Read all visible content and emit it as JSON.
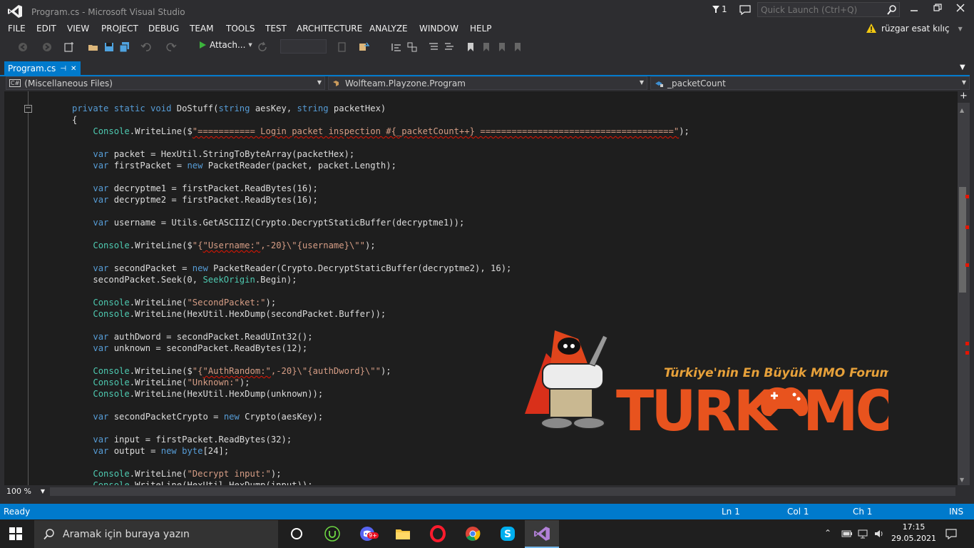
{
  "window": {
    "title": "Program.cs - Microsoft Visual Studio",
    "notification_count": "1",
    "quick_launch_placeholder": "Quick Launch (Ctrl+Q)",
    "user_name": "rüzgar esat kılıç"
  },
  "menu": [
    "FILE",
    "EDIT",
    "VIEW",
    "PROJECT",
    "DEBUG",
    "TEAM",
    "TOOLS",
    "TEST",
    "ARCHITECTURE",
    "ANALYZE",
    "WINDOW",
    "HELP"
  ],
  "toolbar": {
    "attach_label": "Attach..."
  },
  "tab": {
    "label": "Program.cs",
    "pin_glyph": "⊣",
    "close_glyph": "✕"
  },
  "nav": {
    "project": "(Miscellaneous Files)",
    "type": "Wolfteam.Playzone.Program",
    "member": "_packetCount"
  },
  "code_lines": [
    [
      [
        "",
        "private static void "
      ],
      [
        "",
        "DoStuff("
      ],
      [
        "kw",
        "string"
      ],
      [
        "",
        " aesKey, "
      ],
      [
        "kw",
        "string"
      ],
      [
        "",
        " packetHex)"
      ]
    ],
    [
      [
        "",
        "{"
      ]
    ],
    [
      [
        "",
        "    "
      ],
      [
        "ty",
        "Console"
      ],
      [
        "",
        ".WriteLine($"
      ],
      [
        "st squig",
        "\"=========== Login packet inspection #{_packetCount++} =====================================\""
      ],
      [
        "",
        ");"
      ]
    ],
    [],
    [
      [
        "",
        "    "
      ],
      [
        "kw",
        "var"
      ],
      [
        "",
        " packet = HexUtil.StringToByteArray(packetHex);"
      ]
    ],
    [
      [
        "",
        "    "
      ],
      [
        "kw",
        "var"
      ],
      [
        "",
        " firstPacket = "
      ],
      [
        "kw",
        "new"
      ],
      [
        "",
        " PacketReader(packet, packet.Length);"
      ]
    ],
    [],
    [
      [
        "",
        "    "
      ],
      [
        "kw",
        "var"
      ],
      [
        "",
        " decryptme1 = firstPacket.ReadBytes(16);"
      ]
    ],
    [
      [
        "",
        "    "
      ],
      [
        "kw",
        "var"
      ],
      [
        "",
        " decryptme2 = firstPacket.ReadBytes(16);"
      ]
    ],
    [],
    [
      [
        "",
        "    "
      ],
      [
        "kw",
        "var"
      ],
      [
        "",
        " username = Utils.GetASCIIZ(Crypto.DecryptStaticBuffer(decryptme1));"
      ]
    ],
    [],
    [
      [
        "",
        "    "
      ],
      [
        "ty",
        "Console"
      ],
      [
        "",
        ".WriteLine($"
      ],
      [
        "st",
        "\"{"
      ],
      [
        "st squig",
        "\"Username:\""
      ],
      [
        "st",
        ",-20}\\\"{username}\\\"\""
      ],
      [
        "",
        ");"
      ]
    ],
    [],
    [
      [
        "",
        "    "
      ],
      [
        "kw",
        "var"
      ],
      [
        "",
        " secondPacket = "
      ],
      [
        "kw",
        "new"
      ],
      [
        "",
        " PacketReader(Crypto.DecryptStaticBuffer(decryptme2), 16);"
      ]
    ],
    [
      [
        "",
        "    secondPacket.Seek(0, "
      ],
      [
        "ty",
        "SeekOrigin"
      ],
      [
        "",
        ".Begin);"
      ]
    ],
    [],
    [
      [
        "",
        "    "
      ],
      [
        "ty",
        "Console"
      ],
      [
        "",
        ".WriteLine("
      ],
      [
        "st",
        "\"SecondPacket:\""
      ],
      [
        "",
        ");"
      ]
    ],
    [
      [
        "",
        "    "
      ],
      [
        "ty",
        "Console"
      ],
      [
        "",
        ".WriteLine(HexUtil.HexDump(secondPacket.Buffer));"
      ]
    ],
    [],
    [
      [
        "",
        "    "
      ],
      [
        "kw",
        "var"
      ],
      [
        "",
        " authDword = secondPacket.ReadUInt32();"
      ]
    ],
    [
      [
        "",
        "    "
      ],
      [
        "kw",
        "var"
      ],
      [
        "",
        " unknown = secondPacket.ReadBytes(12);"
      ]
    ],
    [],
    [
      [
        "",
        "    "
      ],
      [
        "ty",
        "Console"
      ],
      [
        "",
        ".WriteLine($"
      ],
      [
        "st",
        "\"{"
      ],
      [
        "st squig",
        "\"AuthRandom:\""
      ],
      [
        "st",
        ",-20}\\\"{authDword}\\\"\""
      ],
      [
        "",
        ");"
      ]
    ],
    [
      [
        "",
        "    "
      ],
      [
        "ty",
        "Console"
      ],
      [
        "",
        ".WriteLine("
      ],
      [
        "st",
        "\"Unknown:\""
      ],
      [
        "",
        ");"
      ]
    ],
    [
      [
        "",
        "    "
      ],
      [
        "ty",
        "Console"
      ],
      [
        "",
        ".WriteLine(HexUtil.HexDump(unknown));"
      ]
    ],
    [],
    [
      [
        "",
        "    "
      ],
      [
        "kw",
        "var"
      ],
      [
        "",
        " secondPacketCrypto = "
      ],
      [
        "kw",
        "new"
      ],
      [
        "",
        " Crypto(aesKey);"
      ]
    ],
    [],
    [
      [
        "",
        "    "
      ],
      [
        "kw",
        "var"
      ],
      [
        "",
        " input = firstPacket.ReadBytes(32);"
      ]
    ],
    [
      [
        "",
        "    "
      ],
      [
        "kw",
        "var"
      ],
      [
        "",
        " output = "
      ],
      [
        "kw",
        "new"
      ],
      [
        "",
        " "
      ],
      [
        "kw",
        "byte"
      ],
      [
        "",
        "[24];"
      ]
    ],
    [],
    [
      [
        "",
        "    "
      ],
      [
        "ty",
        "Console"
      ],
      [
        "",
        ".WriteLine("
      ],
      [
        "st",
        "\"Decrypt input:\""
      ],
      [
        "",
        ");"
      ]
    ],
    [
      [
        "",
        "    "
      ],
      [
        "ty",
        "Console"
      ],
      [
        "",
        ".WriteLine(HexUtil.HexDump(input));"
      ]
    ]
  ],
  "editor": {
    "zoom": "100 %"
  },
  "status": {
    "ready": "Ready",
    "ln": "Ln 1",
    "col": "Col 1",
    "ch": "Ch 1",
    "ins": "INS"
  },
  "taskbar": {
    "search_placeholder": "Aramak için buraya yazın",
    "time": "17:15",
    "date": "29.05.2021",
    "discord_badge": "9+"
  },
  "watermark": {
    "tagline": "Türkiye'nin En Büyük MMO Forumu",
    "logo_left": "TURK",
    "logo_right": "MO"
  },
  "colors": {
    "accent": "#007acc",
    "editor_bg": "#1e1e1e",
    "keyword": "#569cd6",
    "type": "#4ec9b0",
    "string": "#d69d85",
    "error": "#e51400"
  }
}
